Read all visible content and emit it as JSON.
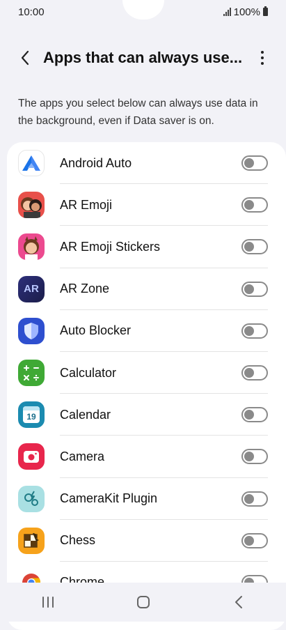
{
  "status": {
    "time": "10:00",
    "battery": "100%"
  },
  "header": {
    "title": "Apps that can always use..."
  },
  "description": "The apps you select below can always use data in the background, even if Data saver is on.",
  "apps": [
    {
      "name": "Android Auto",
      "icon": "android-auto-icon",
      "enabled": false
    },
    {
      "name": "AR Emoji",
      "icon": "ar-emoji-icon",
      "enabled": false
    },
    {
      "name": "AR Emoji Stickers",
      "icon": "ar-emoji-stickers-icon",
      "enabled": false
    },
    {
      "name": "AR Zone",
      "icon": "ar-zone-icon",
      "enabled": false
    },
    {
      "name": "Auto Blocker",
      "icon": "shield-icon",
      "enabled": false
    },
    {
      "name": "Calculator",
      "icon": "calculator-icon",
      "enabled": false
    },
    {
      "name": "Calendar",
      "icon": "calendar-icon",
      "enabled": false
    },
    {
      "name": "Camera",
      "icon": "camera-icon",
      "enabled": false
    },
    {
      "name": "CameraKit Plugin",
      "icon": "camerakit-icon",
      "enabled": false
    },
    {
      "name": "Chess",
      "icon": "chess-icon",
      "enabled": false
    },
    {
      "name": "Chrome",
      "icon": "chrome-icon",
      "enabled": false
    }
  ],
  "calendar_icon_day": "19",
  "ar_zone_icon_text": "AR"
}
